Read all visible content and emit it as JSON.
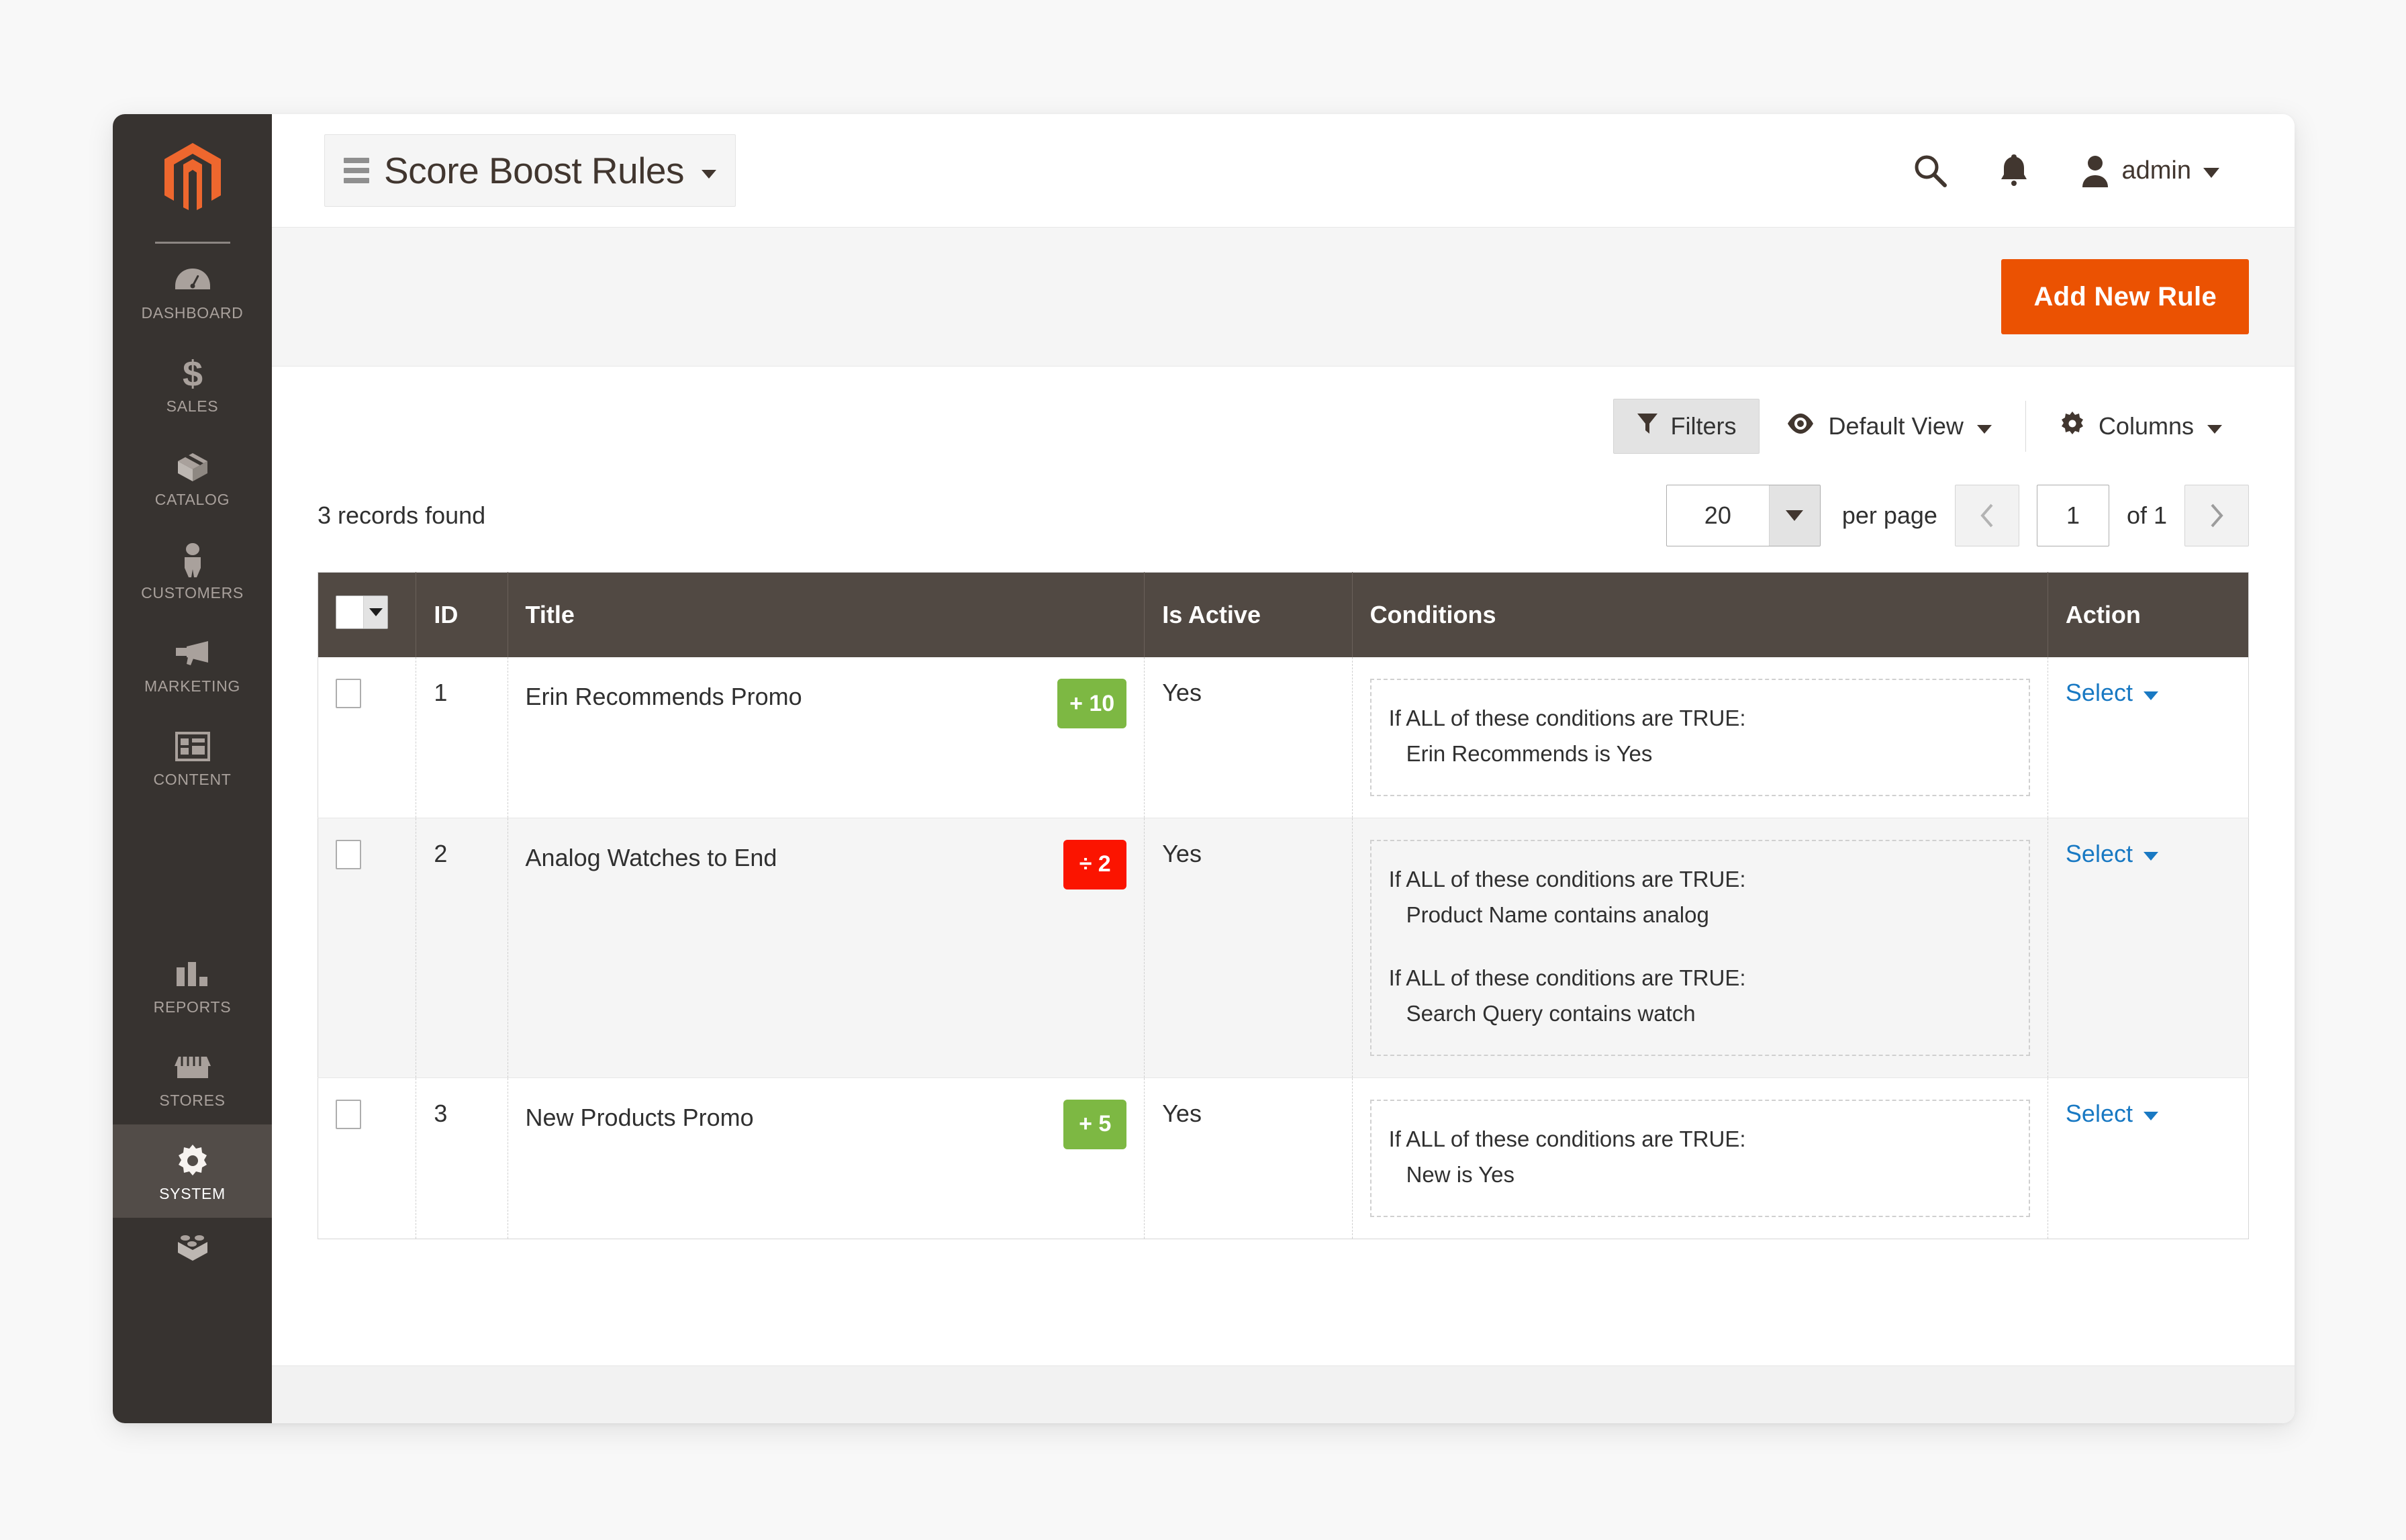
{
  "sidebar": {
    "logo": "magento-logo",
    "items": [
      {
        "label": "DASHBOARD",
        "icon": "dashboard-gauge-icon",
        "active": false
      },
      {
        "label": "SALES",
        "icon": "dollar-sign-icon",
        "active": false
      },
      {
        "label": "CATALOG",
        "icon": "box-icon",
        "active": false
      },
      {
        "label": "CUSTOMERS",
        "icon": "person-icon",
        "active": false
      },
      {
        "label": "MARKETING",
        "icon": "megaphone-icon",
        "active": false
      },
      {
        "label": "CONTENT",
        "icon": "layout-window-icon",
        "active": false
      },
      {
        "label": "REPORTS",
        "icon": "bar-chart-icon",
        "active": false
      },
      {
        "label": "STORES",
        "icon": "storefront-icon",
        "active": false
      },
      {
        "label": "SYSTEM",
        "icon": "gear-icon",
        "active": true
      }
    ],
    "partial_item": {
      "label": "",
      "icon": "puzzle-brick-icon"
    }
  },
  "header": {
    "menu_icon": "hamburger-menu-icon",
    "title": "Score Boost Rules",
    "title_caret": "chevron-down-icon",
    "search_icon": "search-icon",
    "notifications_icon": "bell-icon",
    "avatar_icon": "user-avatar-icon",
    "user_name": "admin",
    "user_caret": "chevron-down-icon"
  },
  "actions": {
    "add_new_rule": "Add New Rule"
  },
  "toolbar": {
    "filters_label": "Filters",
    "filters_icon": "funnel-icon",
    "view_icon": "eye-icon",
    "view_label": "Default View",
    "columns_icon": "gear-icon",
    "columns_label": "Columns"
  },
  "grid_meta": {
    "records_found": "3 records found",
    "per_page_value": "20",
    "per_page_label": "per page",
    "prev_icon": "chevron-left-icon",
    "page_value": "1",
    "of_label": "of 1",
    "next_icon": "chevron-right-icon"
  },
  "grid": {
    "columns": [
      "",
      "ID",
      "Title",
      "Is Active",
      "Conditions",
      "Action"
    ],
    "rows": [
      {
        "id": "1",
        "title": "Erin Recommends Promo",
        "badge": {
          "text": "+ 10",
          "color": "#7db843"
        },
        "is_active": "Yes",
        "conditions": [
          {
            "header": "If ALL of these conditions are TRUE:",
            "detail": "Erin Recommends is Yes"
          }
        ],
        "action": "Select"
      },
      {
        "id": "2",
        "title": "Analog Watches to End",
        "badge": {
          "text": "÷ 2",
          "color": "#fb1400"
        },
        "is_active": "Yes",
        "conditions": [
          {
            "header": "If ALL of these conditions are TRUE:",
            "detail": "Product Name contains analog"
          },
          {
            "header": "If ALL of these conditions are TRUE:",
            "detail": "Search Query contains watch"
          }
        ],
        "action": "Select"
      },
      {
        "id": "3",
        "title": "New Products Promo",
        "badge": {
          "text": "+ 5",
          "color": "#7db843"
        },
        "is_active": "Yes",
        "conditions": [
          {
            "header": "If ALL of these conditions are TRUE:",
            "detail": "New is Yes"
          }
        ],
        "action": "Select"
      }
    ]
  },
  "colors": {
    "brand_orange": "#eb5202",
    "sidebar_bg": "#373330",
    "header_row_bg": "#514943",
    "link_blue": "#1979c3",
    "badge_green": "#7db843",
    "badge_red": "#fb1400"
  }
}
